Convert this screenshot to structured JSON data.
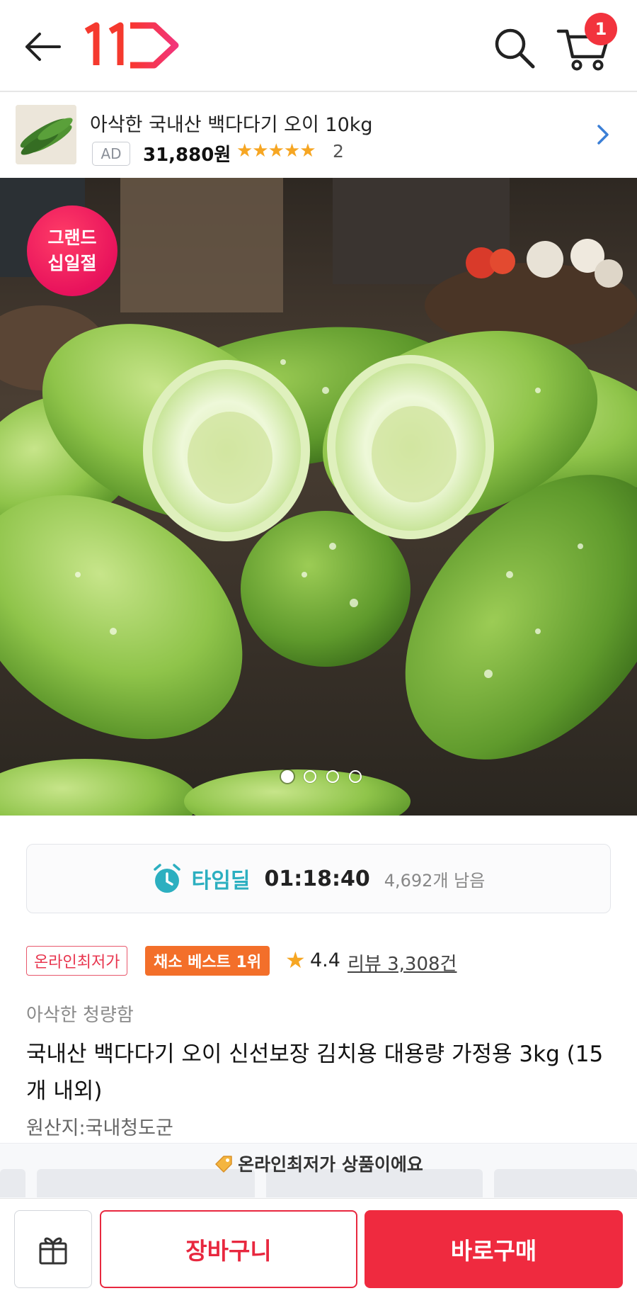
{
  "header": {
    "cart_count": "1",
    "brand_color": "#f2333d"
  },
  "ad": {
    "title": "아삭한 국내산 백다다기 오이 10kg",
    "tag": "AD",
    "price": "31,880원",
    "stars": "★★★★★",
    "review_count": "2"
  },
  "hero": {
    "badge_line1": "그랜드",
    "badge_line2": "십일절",
    "slide_current": 1,
    "slide_total": 4
  },
  "timedeal": {
    "label": "타임딜",
    "countdown": "01:18:40",
    "remaining": "4,692개 남음",
    "accent": "#2cafc0"
  },
  "tags": {
    "lowest_price": "온라인최저가",
    "best_rank": "채소 베스트 1위",
    "rating": "4.4",
    "review_link": "리뷰 3,308건"
  },
  "product": {
    "subtitle": "아삭한 청량함",
    "title": "국내산 백다다기 오이 신선보장 김치용 대용량 가정용 3kg (15개 내외)",
    "origin": "원산지:국내청도군"
  },
  "lowest_strip": {
    "label": "온라인최저가 상품이에요"
  },
  "bottom": {
    "cart_label": "장바구니",
    "buy_label": "바로구매",
    "buy_color": "#ef2a3f"
  }
}
